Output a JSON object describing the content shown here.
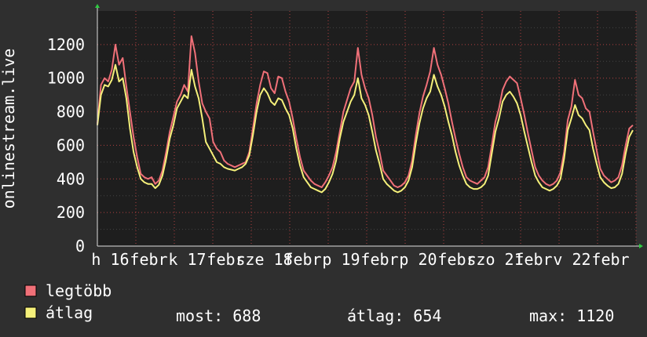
{
  "chart_data": {
    "type": "line",
    "ylabel": "onlinestream.live",
    "ylim": [
      0,
      1400
    ],
    "yticks": [
      0,
      200,
      400,
      600,
      800,
      1000,
      1200
    ],
    "x_tick_labels": [
      "h 16",
      "febr",
      "k 17",
      "febr",
      "sze 18",
      "febr",
      "p 19",
      "febr",
      "p 20",
      "febr",
      "szo 21",
      "febr",
      "v 22",
      "febr"
    ],
    "grid": true,
    "series": [
      {
        "name": "legtöbb",
        "color": "#f07078",
        "values": [
          730,
          960,
          1000,
          980,
          1050,
          1200,
          1080,
          1120,
          950,
          800,
          650,
          530,
          430,
          410,
          400,
          410,
          370,
          390,
          450,
          560,
          680,
          770,
          860,
          900,
          960,
          920,
          1250,
          1150,
          980,
          850,
          800,
          760,
          620,
          580,
          560,
          510,
          490,
          480,
          470,
          480,
          490,
          500,
          560,
          700,
          850,
          960,
          1040,
          1030,
          940,
          910,
          1010,
          1000,
          920,
          860,
          760,
          640,
          530,
          450,
          420,
          390,
          370,
          360,
          350,
          380,
          420,
          470,
          560,
          680,
          800,
          870,
          940,
          980,
          1180,
          1020,
          940,
          880,
          780,
          650,
          560,
          450,
          420,
          390,
          360,
          350,
          360,
          380,
          420,
          510,
          660,
          790,
          890,
          960,
          1040,
          1180,
          1080,
          1020,
          940,
          850,
          740,
          640,
          550,
          470,
          410,
          390,
          380,
          370,
          390,
          410,
          470,
          600,
          740,
          820,
          930,
          980,
          1010,
          990,
          970,
          880,
          780,
          670,
          570,
          470,
          420,
          390,
          370,
          360,
          370,
          390,
          440,
          560,
          750,
          830,
          990,
          900,
          880,
          820,
          800,
          680,
          570,
          460,
          420,
          400,
          380,
          390,
          410,
          480,
          600,
          700,
          720
        ]
      },
      {
        "name": "átlag",
        "color": "#f5f07a",
        "values": [
          720,
          900,
          960,
          950,
          990,
          1080,
          980,
          1000,
          880,
          700,
          560,
          470,
          400,
          380,
          370,
          370,
          345,
          365,
          420,
          520,
          640,
          720,
          820,
          860,
          900,
          880,
          1050,
          950,
          880,
          760,
          620,
          580,
          540,
          500,
          490,
          470,
          460,
          455,
          450,
          460,
          470,
          490,
          540,
          660,
          800,
          900,
          940,
          910,
          860,
          840,
          880,
          870,
          820,
          780,
          700,
          580,
          480,
          410,
          380,
          350,
          340,
          330,
          320,
          340,
          380,
          430,
          510,
          640,
          740,
          800,
          860,
          900,
          1000,
          880,
          840,
          780,
          680,
          570,
          490,
          400,
          370,
          350,
          330,
          320,
          330,
          350,
          390,
          470,
          610,
          730,
          820,
          880,
          920,
          1020,
          950,
          900,
          830,
          740,
          660,
          560,
          480,
          420,
          370,
          350,
          340,
          340,
          350,
          370,
          420,
          550,
          680,
          760,
          860,
          900,
          920,
          890,
          850,
          780,
          680,
          590,
          500,
          420,
          380,
          350,
          340,
          330,
          340,
          360,
          400,
          520,
          690,
          760,
          840,
          780,
          760,
          720,
          690,
          580,
          490,
          410,
          380,
          360,
          345,
          350,
          370,
          430,
          550,
          650,
          690
        ]
      }
    ]
  },
  "legend": [
    {
      "label": "legtöbb",
      "color": "#f07078"
    },
    {
      "label": "átlag",
      "color": "#f5f07a"
    }
  ],
  "stats": [
    {
      "label": "most:",
      "value": "688"
    },
    {
      "label": "átlag:",
      "value": "654"
    },
    {
      "label": "max:",
      "value": "1120"
    }
  ]
}
